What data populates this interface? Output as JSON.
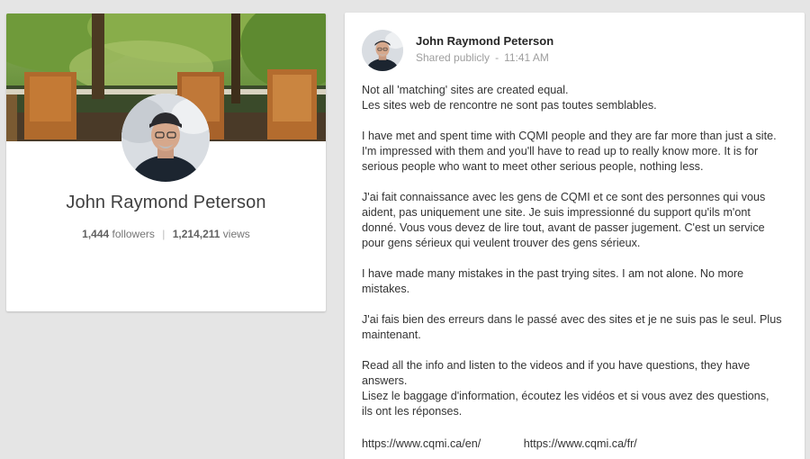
{
  "profile": {
    "name": "John Raymond Peterson",
    "followers_count": "1,444",
    "followers_label": "followers",
    "views_count": "1,214,211",
    "views_label": "views",
    "separator": "|"
  },
  "post": {
    "author": "John Raymond Peterson",
    "visibility": "Shared publicly",
    "meta_dot": "-",
    "time": "11:41 AM",
    "paragraphs": [
      [
        "Not all 'matching' sites are created equal.",
        "Les sites web de rencontre ne sont pas toutes semblables."
      ],
      [
        "I have met and spent time with CQMI people and they are far more than just a site.",
        "I'm impressed with them and you'll have to read up to really know more. It is for",
        "serious people who want to meet other serious people, nothing less."
      ],
      [
        "J'ai fait connaissance avec les gens de CQMI et ce sont des personnes qui vous",
        "aident, pas uniquement une site. Je suis impressionné du support qu'ils m'ont",
        "donné. Vous vous devez de lire tout, avant de passer jugement. C'est un service",
        "pour gens sérieux qui veulent trouver des gens sérieux."
      ],
      [
        "I have made many mistakes in the past trying sites. I am not alone. No more",
        "mistakes."
      ],
      [
        "J'ai fais bien des erreurs dans le passé avec des sites et je ne suis pas le seul. Plus",
        "maintenant."
      ],
      [
        "Read all the info and listen to the videos and if you have questions, they have",
        "answers.",
        "Lisez le baggage d'information, écoutez les vidéos et si vous avez des questions,",
        "ils ont les réponses."
      ]
    ],
    "link_en": "https://www.cqmi.ca/en/",
    "link_fr": "https://www.cqmi.ca/fr/"
  }
}
